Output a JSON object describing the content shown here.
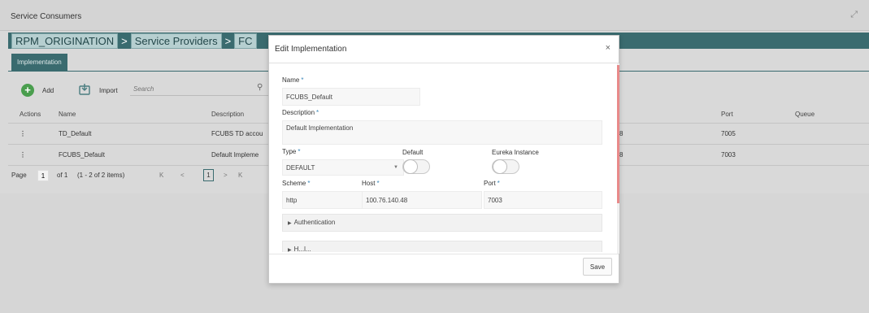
{
  "page": {
    "title": "Service Consumers"
  },
  "breadcrumb": [
    "RPM_ORIGINATION",
    "Service Providers",
    "FC"
  ],
  "breadcrumb_separator": ">",
  "tabs": [
    {
      "label": "Implementation",
      "active": true
    }
  ],
  "toolbar": {
    "add_label": "Add",
    "import_label": "Import",
    "search_placeholder": "Search"
  },
  "table": {
    "columns": [
      "Actions",
      "Name",
      "Description",
      "Port",
      "Queue"
    ],
    "rows": [
      {
        "action": "⋮",
        "name": "TD_Default",
        "description": "FCUBS TD accou",
        "hidden_fragment": "8",
        "port": "7005",
        "queue": ""
      },
      {
        "action": "⋮",
        "name": "FCUBS_Default",
        "description": "Default Impleme",
        "hidden_fragment": "8",
        "port": "7003",
        "queue": ""
      }
    ]
  },
  "pager": {
    "page_label": "Page",
    "page_value": "1",
    "of_label": "of 1",
    "items_label": "(1 - 2 of 2 items)",
    "first": "K",
    "prev": "<",
    "current": "1",
    "next": ">",
    "last": "K"
  },
  "modal": {
    "title": "Edit Implementation",
    "close": "×",
    "required_mark": "*",
    "name_label": "Name",
    "name_value": "FCUBS_Default",
    "description_label": "Description",
    "description_value": "Default Implementation",
    "type_label": "Type",
    "type_value": "DEFAULT",
    "default_label": "Default",
    "default_on": false,
    "eureka_label": "Eureka Instance",
    "eureka_on": false,
    "scheme_label": "Scheme",
    "scheme_value": "http",
    "host_label": "Host",
    "host_value": "100.76.140.48",
    "port_label": "Port",
    "port_value": "7003",
    "authentication_label": "Authentication",
    "headers_label": "H...l...",
    "save_label": "Save"
  },
  "colors": {
    "accent": "#3a6b6f",
    "required": "#3a86b8",
    "add_green": "#4a9e4e",
    "scrollbar": "#e88a8a"
  }
}
